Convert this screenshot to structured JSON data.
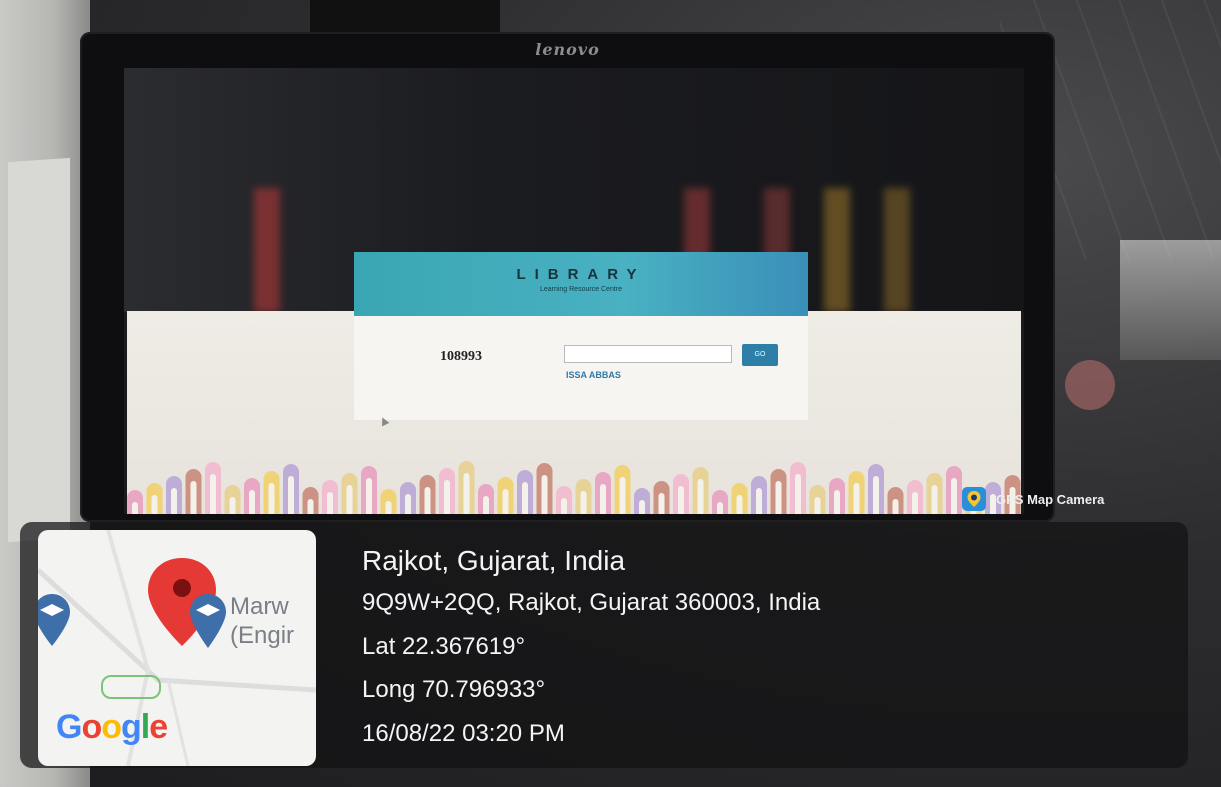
{
  "monitor": {
    "brand": "lenovo"
  },
  "library_page": {
    "title": "LIBRARY",
    "subtitle": "Learning Resource Centre",
    "member_number": "108993",
    "input_value": "",
    "go_label": "GO",
    "member_name": "ISSA ABBAS"
  },
  "gps_badge": {
    "icon": "map-pin-camera-icon",
    "label": "GPS Map Camera"
  },
  "map_thumbnail": {
    "place_label": "Marw\n(Engir",
    "logo_letters": [
      {
        "char": "G",
        "color": "#4285F4"
      },
      {
        "char": "o",
        "color": "#EA4335"
      },
      {
        "char": "o",
        "color": "#FBBC05"
      },
      {
        "char": "g",
        "color": "#4285F4"
      },
      {
        "char": "l",
        "color": "#34A853"
      },
      {
        "char": "e",
        "color": "#EA4335"
      }
    ],
    "pin_color": "#E53935",
    "school_marker_color": "#3F6FA8"
  },
  "location": {
    "city": "Rajkot, Gujarat, India",
    "address": "9Q9W+2QQ, Rajkot, Gujarat 360003, India",
    "lat": "Lat 22.367619°",
    "long": "Long 70.796933°",
    "timestamp": "16/08/22 03:20 PM"
  },
  "colors": {
    "header_teal": "#3aa6b3",
    "go_blue": "#2e7fa8",
    "link_blue": "#2f78a6",
    "bubble_palette": [
      "#e8a0c0",
      "#f1d06a",
      "#b9a6d6",
      "#c98a7a",
      "#f2b9cf",
      "#e7cf8f"
    ]
  }
}
